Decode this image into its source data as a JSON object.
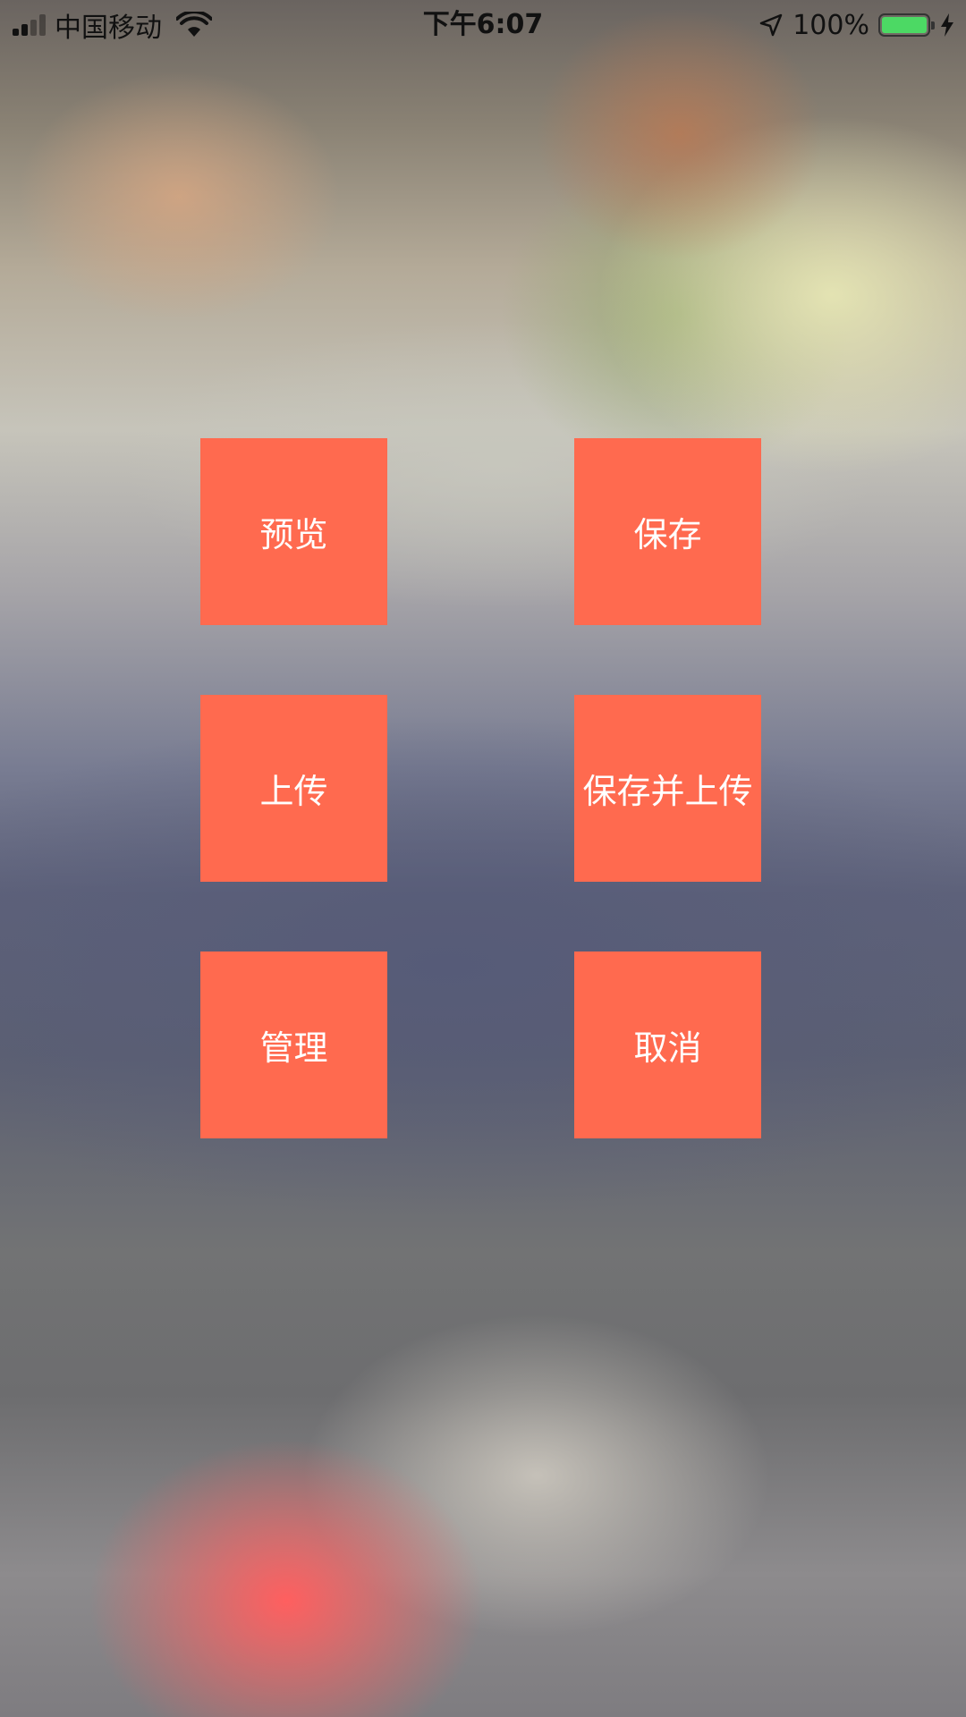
{
  "status_bar": {
    "carrier": "中国移动",
    "time": "下午6:07",
    "battery_percent": "100%",
    "battery_level": 1.0,
    "battery_color": "#4cd964",
    "icons": [
      "signal-icon",
      "wifi-icon",
      "location-arrow-icon",
      "battery-icon",
      "charging-bolt-icon"
    ]
  },
  "buttons": {
    "preview": "预览",
    "save": "保存",
    "upload": "上传",
    "save_and_upload": "保存并上传",
    "manage": "管理",
    "cancel": "取消"
  },
  "colors": {
    "button_bg": "#ff6a4f",
    "button_text": "#ffffff"
  }
}
